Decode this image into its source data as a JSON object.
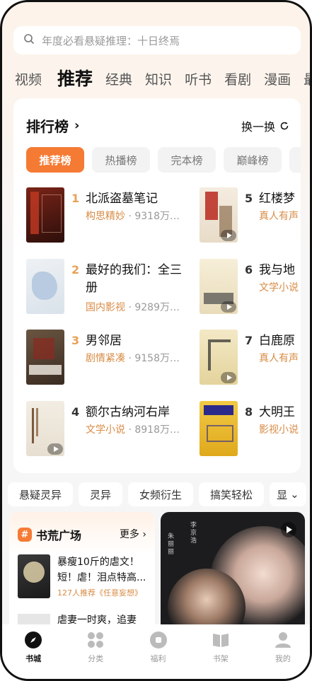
{
  "search": {
    "placeholder": "年度必看悬疑推理：十日终焉"
  },
  "categories": [
    "视频",
    "推荐",
    "经典",
    "知识",
    "听书",
    "看剧",
    "漫画",
    "最"
  ],
  "ranking": {
    "title": "排行榜",
    "shuffle_label": "换一换",
    "tabs": [
      "推荐榜",
      "热播榜",
      "完本榜",
      "巅峰榜"
    ],
    "books": [
      {
        "rank": "1",
        "title": "北派盗墓笔记",
        "tag": "构思精妙",
        "count": "· 9318万…",
        "has_play": false
      },
      {
        "rank": "2",
        "title": "最好的我们：全三",
        "title2": "册",
        "tag": "国内影视",
        "count": "· 9289万…",
        "has_play": false
      },
      {
        "rank": "3",
        "title": "男邻居",
        "tag": "剧情紧凑",
        "count": "· 9158万…",
        "has_play": false
      },
      {
        "rank": "4",
        "title": "额尔古纳河右岸",
        "tag": "文学小说",
        "count": "· 8918万…",
        "has_play": true
      },
      {
        "rank": "5",
        "title": "红楼梦",
        "tag": "真人有声",
        "count": "",
        "has_play": true
      },
      {
        "rank": "6",
        "title": "我与地",
        "tag": "文学小说",
        "count": "",
        "has_play": true
      },
      {
        "rank": "7",
        "title": "白鹿原",
        "tag": "真人有声",
        "count": "",
        "has_play": true
      },
      {
        "rank": "8",
        "title": "大明王",
        "tag": "影视小说",
        "count": "",
        "has_play": false
      }
    ]
  },
  "genre_tags": [
    "悬疑灵异",
    "灵异",
    "女频衍生",
    "搞笑轻松",
    "显"
  ],
  "book_square": {
    "title": "书荒广场",
    "more": "更多",
    "item1_line1": "暴瘦10斤的虐文！",
    "item1_line2": "短！虐！泪点特高...",
    "item1_reco": "127人推荐《任意妄想》",
    "item2_line1": "虐妻一时爽，追妻"
  },
  "promo": {
    "cast1": "朱丽丽",
    "cast2": "李京浩"
  },
  "nav": [
    {
      "label": "书城",
      "icon": "compass-icon",
      "active": true
    },
    {
      "label": "分类",
      "icon": "grid-icon",
      "active": false
    },
    {
      "label": "福利",
      "icon": "coin-icon",
      "active": false
    },
    {
      "label": "书架",
      "icon": "book-icon",
      "active": false
    },
    {
      "label": "我的",
      "icon": "person-icon",
      "active": false
    }
  ],
  "colors": {
    "accent": "#f57b35",
    "tag_orange": "#d88b45",
    "rank_top": "#e8a15a"
  }
}
